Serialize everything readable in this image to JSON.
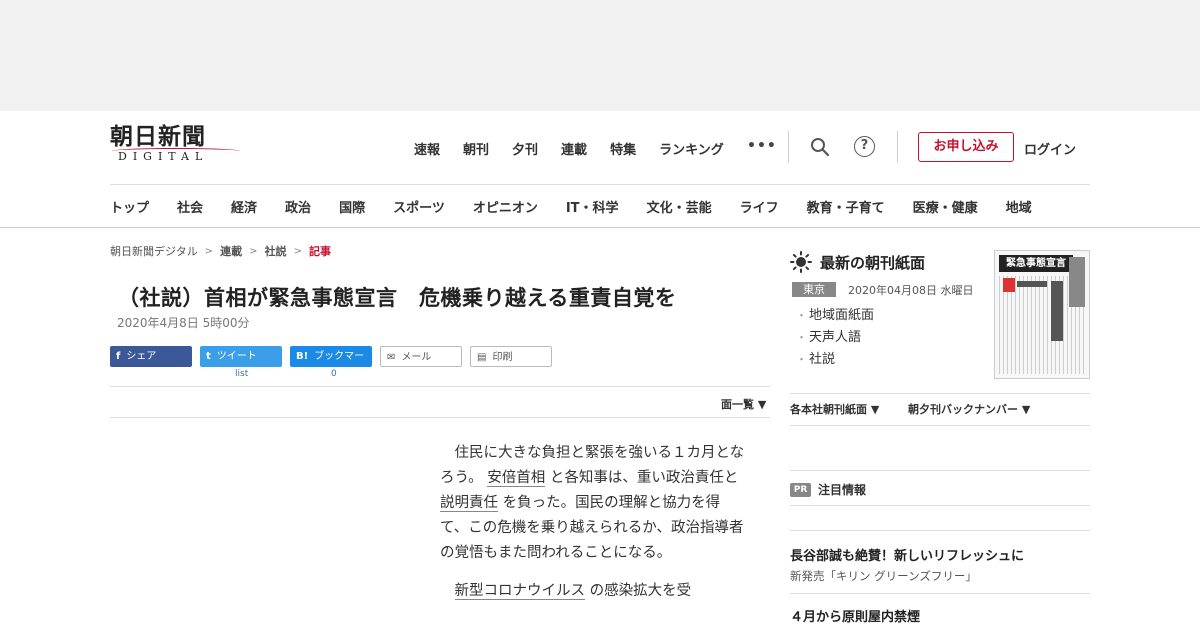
{
  "logo": {
    "main": "朝日新聞",
    "sub": "DIGITAL"
  },
  "topnav": [
    "速報",
    "朝刊",
    "夕刊",
    "連載",
    "特集",
    "ランキング"
  ],
  "more_label": "•••",
  "header": {
    "help_glyph": "?",
    "apply_label": "お申し込み",
    "login_label": "ログイン"
  },
  "catnav": [
    "トップ",
    "社会",
    "経済",
    "政治",
    "国際",
    "スポーツ",
    "オピニオン",
    "IT・科学",
    "文化・芸能",
    "ライフ",
    "教育・子育て",
    "医療・健康",
    "地域"
  ],
  "breadcrumb": [
    "朝日新聞デジタル",
    "連載",
    "社説",
    "記事"
  ],
  "article": {
    "title": "（社説）首相が緊急事態宣言　危機乗り越える重責自覚を",
    "date": "2020年4月8日 5時00分",
    "paragraph1": {
      "a": "住民に大きな負担と緊張を強いる１カ月となろう。",
      "kw1": "安倍首相",
      "b": "と各知事は、重い政治責任と",
      "kw2": "説明責任",
      "c": "を負った。国民の理解と協力を得て、この危機を乗り越えられるか、政治指導者の覚悟もまた問われることになる。"
    },
    "paragraph2": {
      "kw": "新型コロナウイルス",
      "a": "の感染拡大を受"
    }
  },
  "share": {
    "facebook": {
      "icon": "f",
      "label": "シェア"
    },
    "twitter": {
      "icon": "t",
      "label": "ツイート",
      "count": "list"
    },
    "hatena": {
      "icon": "B!",
      "label": "ブックマーク",
      "count": "0"
    },
    "mail": {
      "icon": "✉",
      "label": "メール"
    },
    "print": {
      "icon": "▤",
      "label": "印刷"
    }
  },
  "page_list_label": "面一覧 ▼",
  "sidebar": {
    "title": "最新の朝刊紙面",
    "edition": "東京",
    "edition_date": "2020年04月08日 水曜日",
    "links": [
      "地域面紙面",
      "天声人語",
      "社説"
    ],
    "paper_headline": "緊急事態宣言",
    "menu1": "各本社朝刊紙面 ▼",
    "menu2": "朝夕刊バックナンバー ▼",
    "pr_badge": "PR",
    "pr_title": "注目情報",
    "ad1_title": "長谷部誠も絶賛！新しいリフレッシュに",
    "ad1_sub": "新発売「キリン グリーンズフリー」",
    "ad2_title": "４月から原則屋内禁煙"
  },
  "colors": {
    "accent": "#c8102e",
    "facebook": "#3b5998",
    "twitter": "#3a9fe8",
    "hatena": "#1b8ae6"
  }
}
